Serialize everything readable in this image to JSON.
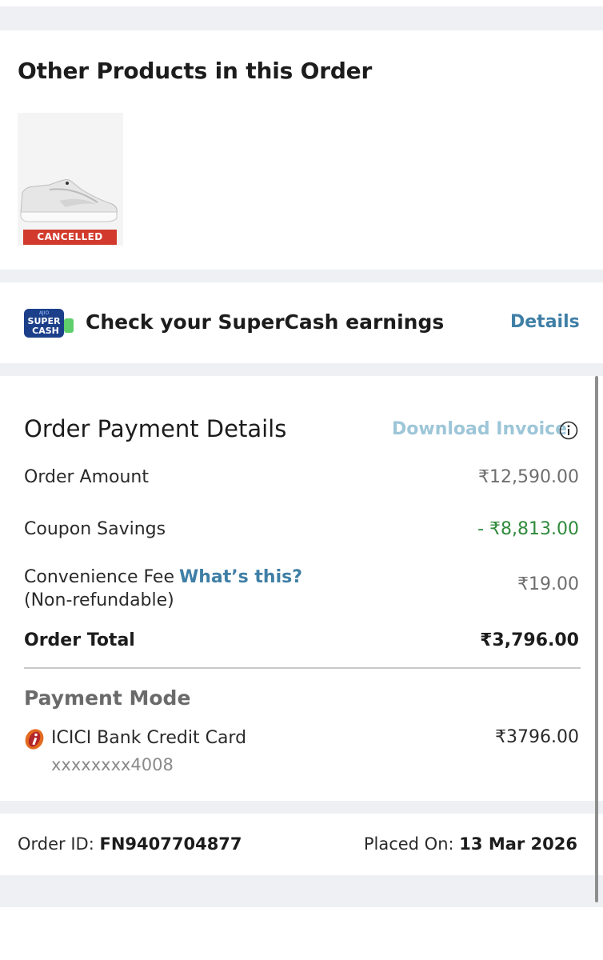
{
  "other_products": {
    "title": "Other Products in this Order",
    "items": [
      {
        "image": "white-sneaker",
        "status": "CANCELLED"
      }
    ]
  },
  "supercash": {
    "logo_top": "AJIO",
    "logo_line1": "SUPER",
    "logo_line2": "CASH",
    "text": "Check your SuperCash earnings",
    "details_label": "Details"
  },
  "payment": {
    "title": "Order Payment Details",
    "download_invoice": "Download Invoice",
    "rows": {
      "order_amount": {
        "label": "Order Amount",
        "value": "₹12,590.00"
      },
      "coupon_savings": {
        "label": "Coupon Savings",
        "value": "- ₹8,813.00"
      },
      "convenience_fee": {
        "label": "Convenience Fee",
        "sublabel": "(Non-refundable)",
        "link": "What’s this?",
        "value": "₹19.00"
      },
      "order_total": {
        "label": "Order Total",
        "value": "₹3,796.00"
      }
    },
    "mode": {
      "title": "Payment Mode",
      "bank": "ICICI Bank Credit Card",
      "card": "xxxxxxxx4008",
      "amount": "₹3796.00"
    }
  },
  "order": {
    "id_label": "Order ID:",
    "id": "FN9407704877",
    "placed_label": "Placed On:",
    "placed_date": "13 Mar 2026"
  },
  "colors": {
    "accent_link": "#3f7fa6",
    "cancel_badge": "#d13a2c",
    "savings_green": "#2f8a3b",
    "section_gap": "#eef0f4"
  }
}
